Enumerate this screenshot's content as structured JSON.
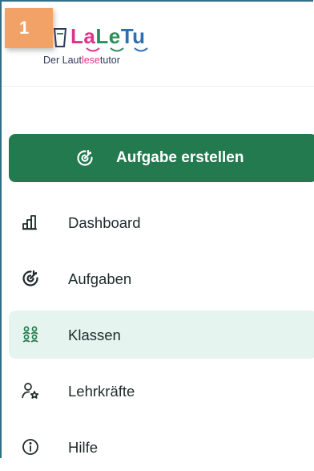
{
  "step_badge": "1",
  "logo": {
    "word_part1": "La",
    "word_part2": "Le",
    "word_part3": "Tu",
    "subtitle_part1": "Der Laut",
    "subtitle_part2": "lese",
    "subtitle_part3": "tutor"
  },
  "create_button": {
    "label": "Aufgabe erstellen",
    "icon": "target-plus-icon"
  },
  "nav": [
    {
      "label": "Dashboard",
      "icon": "bar-chart-icon",
      "active": false
    },
    {
      "label": "Aufgaben",
      "icon": "target-plus-icon",
      "active": false
    },
    {
      "label": "Klassen",
      "icon": "group-icon",
      "active": true
    },
    {
      "label": "Lehrkräfte",
      "icon": "user-star-icon",
      "active": false
    },
    {
      "label": "Hilfe",
      "icon": "info-circle-icon",
      "active": false
    }
  ],
  "colors": {
    "primary": "#237a4f",
    "active_bg": "#e6f4ef",
    "badge": "#f2a266",
    "logo_pink": "#e0338f",
    "logo_green": "#2c8e5a",
    "logo_blue": "#2f6fb0"
  }
}
